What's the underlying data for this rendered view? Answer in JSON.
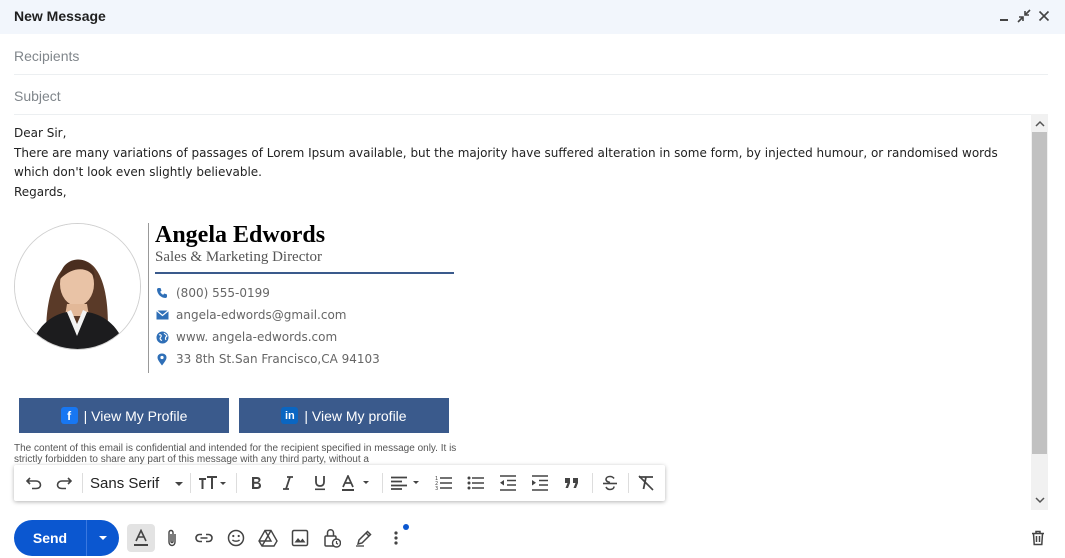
{
  "window": {
    "title": "New Message"
  },
  "fields": {
    "recipients_placeholder": "Recipients",
    "subject_placeholder": "Subject"
  },
  "body": {
    "greeting": "Dear Sir,",
    "paragraph": "There are many variations of passages of Lorem Ipsum available, but the majority have suffered alteration in some form, by injected humour, or randomised words which don't look even slightly believable.",
    "closing": "Regards,"
  },
  "signature": {
    "name": "Angela Edwords",
    "title": "Sales & Marketing Director",
    "phone": "(800) 555-0199",
    "email": "angela-edwords@gmail.com",
    "website": "www. angela-edwords.com",
    "address": "33 8th St.San Francisco,CA 94103",
    "facebook_button": "| View My Profile",
    "linkedin_button": "| View My profile",
    "disclaimer": "The content of this email is confidential and intended for the recipient specified in message only. It is strictly forbidden to share any part of this message with any third party, without a"
  },
  "toolbar": {
    "font": "Sans Serif"
  },
  "actions": {
    "send_label": "Send"
  },
  "colors": {
    "accent": "#0b57d0",
    "signature_blue": "#3a5a8c",
    "facebook": "#1877f2",
    "linkedin": "#0a66c2"
  }
}
